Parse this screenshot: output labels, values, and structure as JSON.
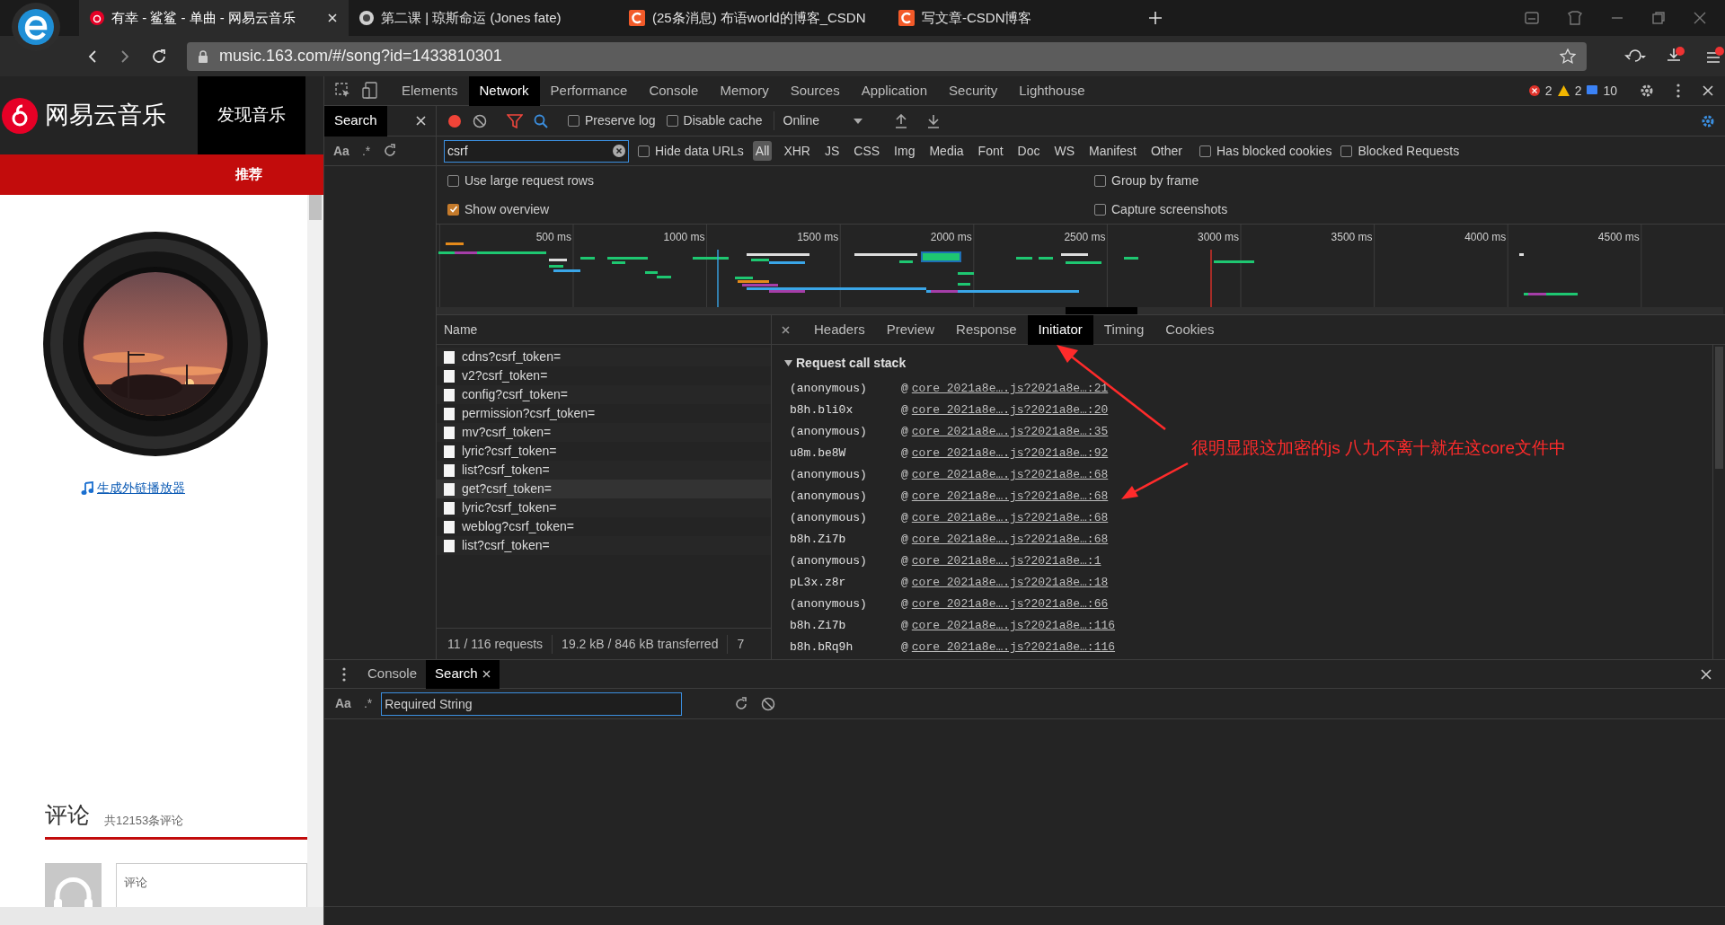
{
  "browser": {
    "tabs": [
      {
        "kind": "netease",
        "title": "有幸 - 鲨鲨 - 单曲 - 网易云音乐",
        "selected": true
      },
      {
        "kind": "site",
        "title": "第二课 | 琼斯命运  (Jones fate)",
        "selected": false
      },
      {
        "kind": "csdn",
        "title": "(25条消息) 布语world的博客_CSDN",
        "selected": false
      },
      {
        "kind": "csdn",
        "title": "写文章-CSDN博客",
        "selected": false
      }
    ],
    "address": "music.163.com/#/song?id=1433810301"
  },
  "page": {
    "logo": "网易云音乐",
    "nav": [
      {
        "label": "发现音乐",
        "selected": true
      }
    ],
    "subnav": [
      {
        "label": "推荐",
        "selected": true
      }
    ],
    "player_link": "生成外链播放器",
    "comments_title": "评论",
    "comments_count": "共12153条评论",
    "comment_placeholder": "评论"
  },
  "devtools": {
    "tabs": [
      {
        "label": "Elements",
        "selected": false
      },
      {
        "label": "Network",
        "selected": true
      },
      {
        "label": "Performance",
        "selected": false
      },
      {
        "label": "Console",
        "selected": false
      },
      {
        "label": "Memory",
        "selected": false
      },
      {
        "label": "Sources",
        "selected": false
      },
      {
        "label": "Application",
        "selected": false
      },
      {
        "label": "Security",
        "selected": false
      },
      {
        "label": "Lighthouse",
        "selected": false
      }
    ],
    "counts": {
      "errors": "2",
      "warnings": "2",
      "messages": "10"
    },
    "search_panel": {
      "title": "Search",
      "case_toggle": "Aa",
      "regex_toggle": ".*"
    },
    "toolbar": {
      "recording": true,
      "preserve_log": {
        "label": "Preserve log",
        "checked": false
      },
      "disable_cache": {
        "label": "Disable cache",
        "checked": false
      },
      "throttle": "Online"
    },
    "filter": {
      "value": "csrf",
      "hide_data_urls": {
        "label": "Hide data URLs",
        "checked": false
      },
      "types": [
        {
          "label": "All",
          "selected": true
        },
        {
          "label": "XHR",
          "selected": false
        },
        {
          "label": "JS",
          "selected": false
        },
        {
          "label": "CSS",
          "selected": false
        },
        {
          "label": "Img",
          "selected": false
        },
        {
          "label": "Media",
          "selected": false
        },
        {
          "label": "Font",
          "selected": false
        },
        {
          "label": "Doc",
          "selected": false
        },
        {
          "label": "WS",
          "selected": false
        },
        {
          "label": "Manifest",
          "selected": false
        },
        {
          "label": "Other",
          "selected": false
        }
      ],
      "has_blocked_cookies": {
        "label": "Has blocked cookies",
        "checked": false
      },
      "blocked_requests": {
        "label": "Blocked Requests",
        "checked": false
      }
    },
    "options": [
      {
        "label": "Use large request rows",
        "checked": false
      },
      {
        "label": "Group by frame",
        "checked": false
      },
      {
        "label": "Show overview",
        "checked": true
      },
      {
        "label": "Capture screenshots",
        "checked": false
      }
    ],
    "overview": {
      "ticks": [
        "500 ms",
        "1000 ms",
        "1500 ms",
        "2000 ms",
        "2500 ms",
        "3000 ms",
        "3500 ms",
        "4000 ms",
        "4500 ms"
      ]
    },
    "requests": {
      "column": "Name",
      "rows": [
        {
          "name": "cdns?csrf_token=",
          "selected": false
        },
        {
          "name": "v2?csrf_token=",
          "selected": false
        },
        {
          "name": "config?csrf_token=",
          "selected": false
        },
        {
          "name": "permission?csrf_token=",
          "selected": false
        },
        {
          "name": "mv?csrf_token=",
          "selected": false
        },
        {
          "name": "lyric?csrf_token=",
          "selected": false
        },
        {
          "name": "list?csrf_token=",
          "selected": false
        },
        {
          "name": "get?csrf_token=",
          "selected": true
        },
        {
          "name": "lyric?csrf_token=",
          "selected": false
        },
        {
          "name": "weblog?csrf_token=",
          "selected": false
        },
        {
          "name": "list?csrf_token=",
          "selected": false
        }
      ],
      "status": [
        "11 / 116 requests",
        "19.2 kB / 846 kB transferred",
        "7"
      ]
    },
    "details": {
      "tabs": [
        {
          "label": "Headers",
          "selected": false
        },
        {
          "label": "Preview",
          "selected": false
        },
        {
          "label": "Response",
          "selected": false
        },
        {
          "label": "Initiator",
          "selected": true
        },
        {
          "label": "Timing",
          "selected": false
        },
        {
          "label": "Cookies",
          "selected": false
        }
      ],
      "section": {
        "title": "Request call stack",
        "expanded": true
      },
      "frames": [
        {
          "function": "(anonymous)",
          "separator": "@",
          "location": "core_2021a8e….js?2021a8e…:21"
        },
        {
          "function": "b8h.bli0x",
          "separator": "@",
          "location": "core_2021a8e….js?2021a8e…:20"
        },
        {
          "function": "(anonymous)",
          "separator": "@",
          "location": "core_2021a8e….js?2021a8e…:35"
        },
        {
          "function": "u8m.be8W",
          "separator": "@",
          "location": "core_2021a8e….js?2021a8e…:92"
        },
        {
          "function": "(anonymous)",
          "separator": "@",
          "location": "core_2021a8e….js?2021a8e…:68"
        },
        {
          "function": "(anonymous)",
          "separator": "@",
          "location": "core_2021a8e….js?2021a8e…:68"
        },
        {
          "function": "(anonymous)",
          "separator": "@",
          "location": "core_2021a8e….js?2021a8e…:68"
        },
        {
          "function": "b8h.Zi7b",
          "separator": "@",
          "location": "core_2021a8e….js?2021a8e…:68"
        },
        {
          "function": "(anonymous)",
          "separator": "@",
          "location": "core_2021a8e….js?2021a8e…:1"
        },
        {
          "function": "pL3x.z8r",
          "separator": "@",
          "location": "core_2021a8e….js?2021a8e…:18"
        },
        {
          "function": "(anonymous)",
          "separator": "@",
          "location": "core_2021a8e….js?2021a8e…:66"
        },
        {
          "function": "b8h.Zi7b",
          "separator": "@",
          "location": "core_2021a8e….js?2021a8e…:116"
        },
        {
          "function": "b8h.bRq9h",
          "separator": "@",
          "location": "core_2021a8e….js?2021a8e…:116"
        }
      ]
    },
    "drawer": {
      "tabs": [
        {
          "label": "Console",
          "selected": false
        },
        {
          "label": "Search",
          "selected": true
        }
      ],
      "case_toggle": "Aa",
      "regex_toggle": ".*",
      "search_value": "Required String"
    }
  },
  "annotation": {
    "text": "很明显跟这加密的js 八九不离十就在这core文件中"
  }
}
